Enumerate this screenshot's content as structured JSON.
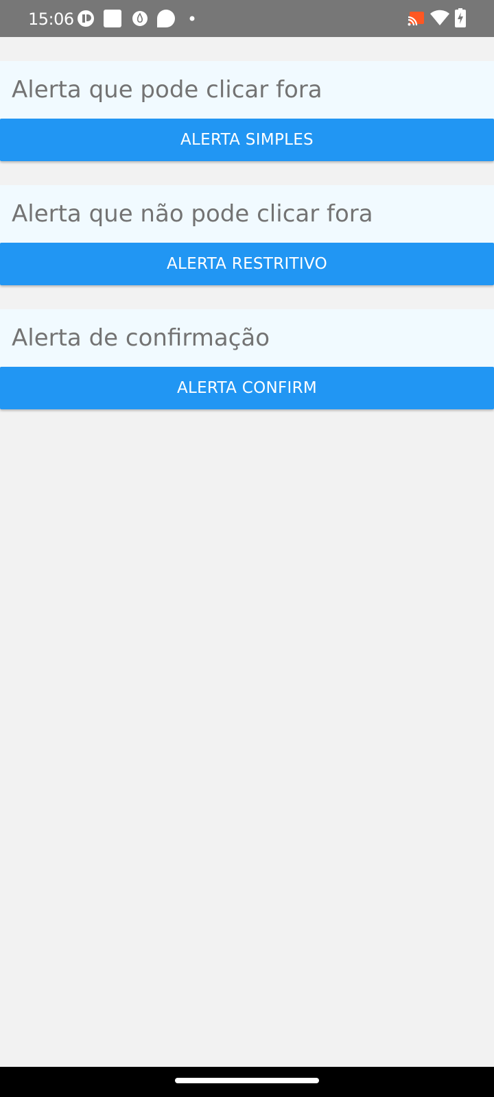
{
  "status_bar": {
    "time": "15:06",
    "left_icons": [
      "record-icon",
      "square-app-icon",
      "flame-app-icon",
      "chat-bubble-icon",
      "notification-dot-icon"
    ],
    "right_icons": [
      "cast-icon",
      "wifi-icon",
      "battery-charging-icon"
    ]
  },
  "alerts": [
    {
      "title": "Alerta que pode clicar fora",
      "button_label": "ALERTA SIMPLES"
    },
    {
      "title": "Alerta que não pode clicar fora",
      "button_label": "ALERTA RESTRITIVO"
    },
    {
      "title": "Alerta de confirmação",
      "button_label": "ALERTA CONFIRM"
    }
  ],
  "colors": {
    "status_bar": "#777777",
    "background": "#f2f2f2",
    "card_background": "#f1faff",
    "button": "#2196f3",
    "button_text": "#ffffff",
    "title_text": "#737373",
    "cast_accent": "#ff5722"
  }
}
